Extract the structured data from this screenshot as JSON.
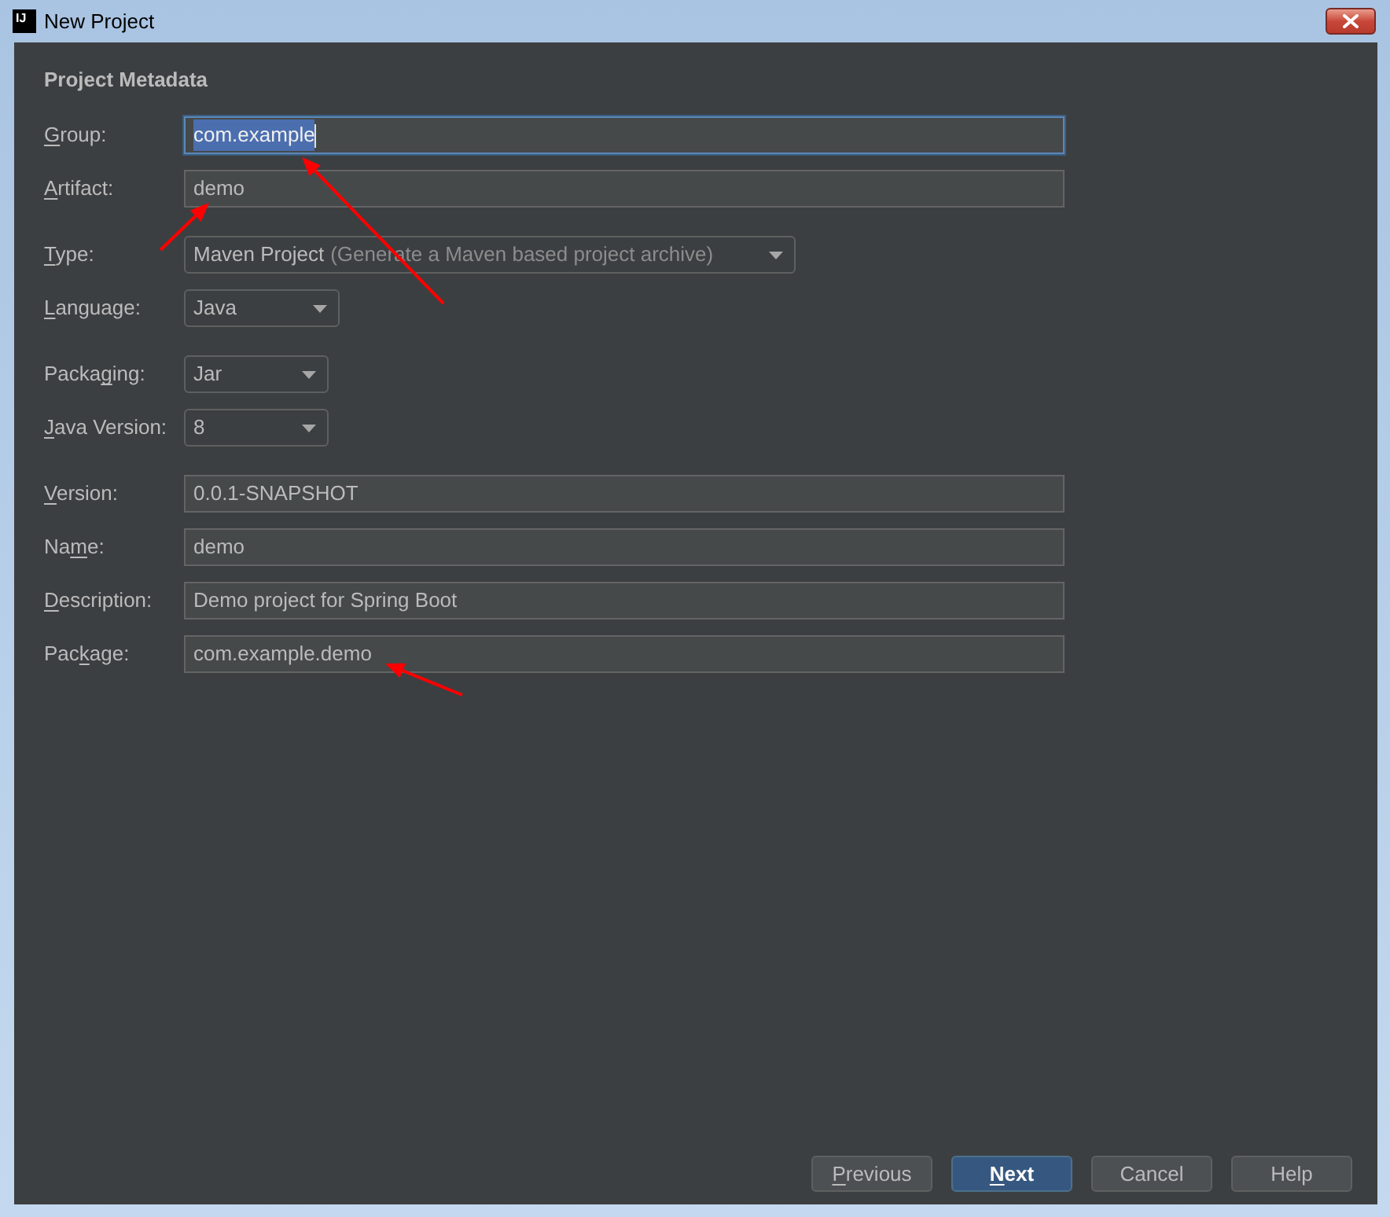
{
  "window": {
    "icon_text": "IJ",
    "title": "New Project"
  },
  "section": {
    "title": "Project Metadata"
  },
  "field_groups": [
    [
      {
        "kind": "text",
        "label": [
          {
            "text": "G",
            "underlined": true
          },
          {
            "text": "roup:",
            "underlined": false
          }
        ],
        "value": "com.example",
        "focused": true,
        "text_selected": true
      },
      {
        "kind": "text",
        "label": [
          {
            "text": "A",
            "underlined": true
          },
          {
            "text": "rtifact:",
            "underlined": false
          }
        ],
        "value": "demo",
        "focused": false,
        "text_selected": false
      }
    ],
    [
      {
        "kind": "dropdown",
        "label": [
          {
            "text": "T",
            "underlined": true
          },
          {
            "text": "ype:",
            "underlined": false
          }
        ],
        "value": "Maven Project",
        "note": "(Generate a Maven based project archive)"
      },
      {
        "kind": "dropdown",
        "label": [
          {
            "text": "L",
            "underlined": true
          },
          {
            "text": "anguage:",
            "underlined": false
          }
        ],
        "value": "Java"
      }
    ],
    [
      {
        "kind": "dropdown",
        "label": [
          {
            "text": "Packa",
            "underlined": false
          },
          {
            "text": "g",
            "underlined": true
          },
          {
            "text": "ing:",
            "underlined": false
          }
        ],
        "value": "Jar"
      },
      {
        "kind": "dropdown",
        "label": [
          {
            "text": "J",
            "underlined": true
          },
          {
            "text": "ava Version:",
            "underlined": false
          }
        ],
        "value": "8"
      }
    ],
    [
      {
        "kind": "text",
        "label": [
          {
            "text": "V",
            "underlined": true
          },
          {
            "text": "ersion:",
            "underlined": false
          }
        ],
        "value": "0.0.1-SNAPSHOT",
        "focused": false,
        "text_selected": false
      },
      {
        "kind": "text",
        "label": [
          {
            "text": "Na",
            "underlined": false
          },
          {
            "text": "m",
            "underlined": true
          },
          {
            "text": "e:",
            "underlined": false
          }
        ],
        "value": "demo",
        "focused": false,
        "text_selected": false
      },
      {
        "kind": "text",
        "label": [
          {
            "text": "D",
            "underlined": true
          },
          {
            "text": "escription:",
            "underlined": false
          }
        ],
        "value": "Demo project for Spring Boot",
        "focused": false,
        "text_selected": false
      },
      {
        "kind": "text",
        "label": [
          {
            "text": "Pac",
            "underlined": false
          },
          {
            "text": "k",
            "underlined": true
          },
          {
            "text": "age:",
            "underlined": false
          }
        ],
        "value": "com.example.demo",
        "focused": false,
        "text_selected": false
      }
    ]
  ],
  "annotation_arrows": [
    {
      "kind": "arrow"
    },
    {
      "kind": "arrow"
    },
    {
      "kind": "arrow"
    }
  ],
  "buttons": [
    {
      "kind": "secondary",
      "label": [
        {
          "text": "P",
          "underlined": true
        },
        {
          "text": "revious",
          "underlined": false
        }
      ]
    },
    {
      "kind": "default",
      "label": [
        {
          "text": "N",
          "underlined": true
        },
        {
          "text": "ext",
          "underlined": false
        }
      ]
    },
    {
      "kind": "secondary",
      "label": [
        {
          "text": "Cancel",
          "underlined": false
        }
      ]
    },
    {
      "kind": "secondary",
      "label": [
        {
          "text": "Help",
          "underlined": false
        }
      ]
    }
  ]
}
